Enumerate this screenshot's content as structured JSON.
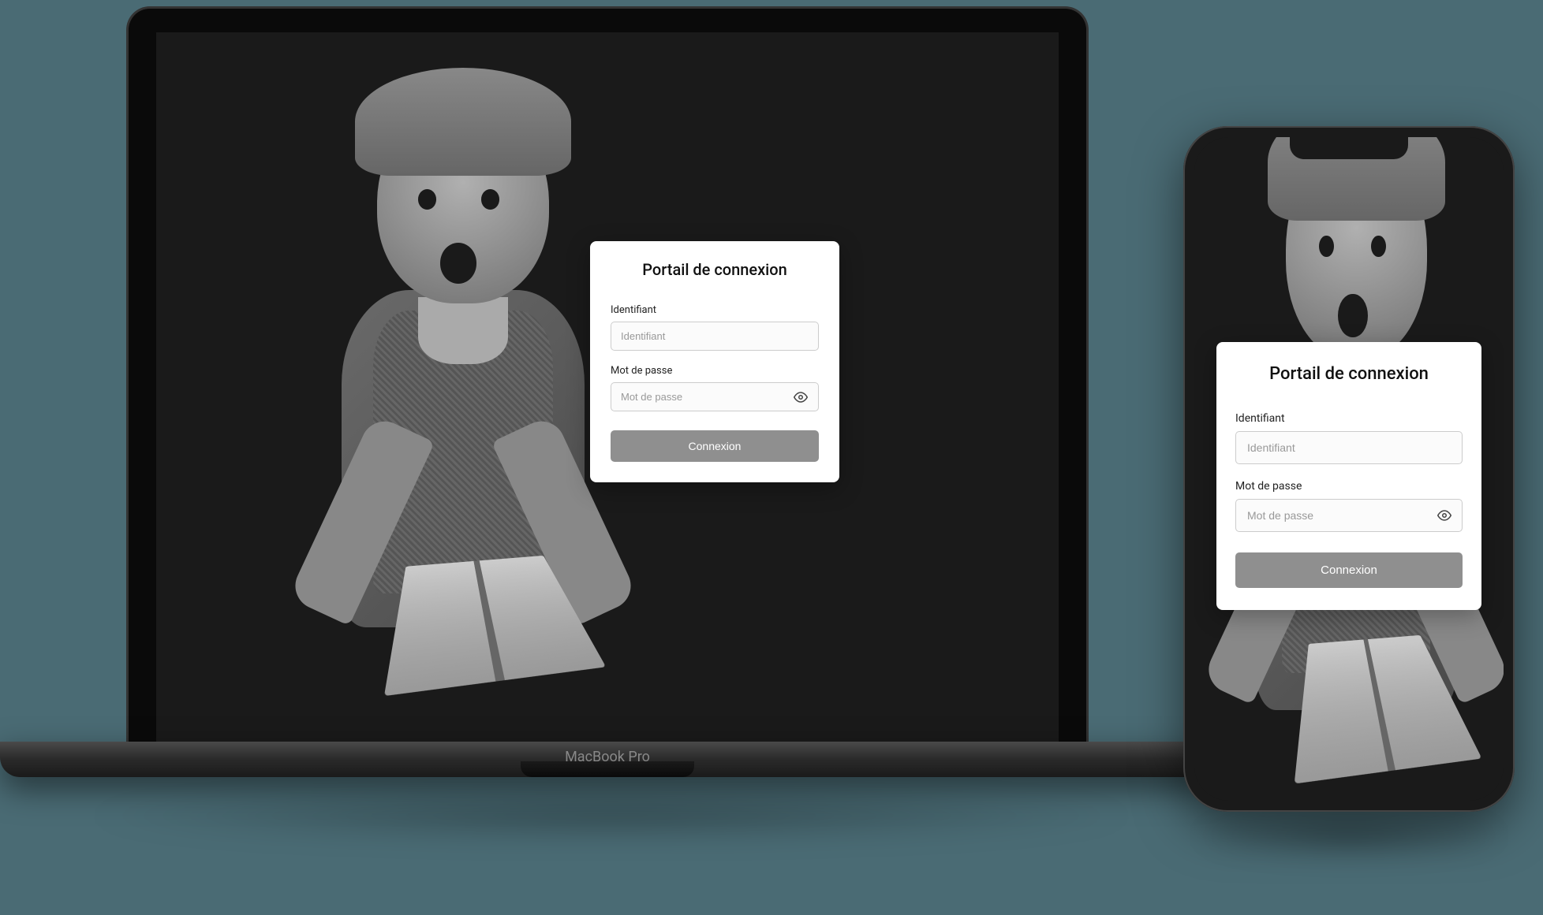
{
  "device": {
    "laptop_label": "MacBook Pro"
  },
  "login": {
    "title": "Portail de connexion",
    "identifier_label": "Identifiant",
    "identifier_placeholder": "Identifiant",
    "password_label": "Mot de passe",
    "password_placeholder": "Mot de passe",
    "submit_label": "Connexion"
  }
}
